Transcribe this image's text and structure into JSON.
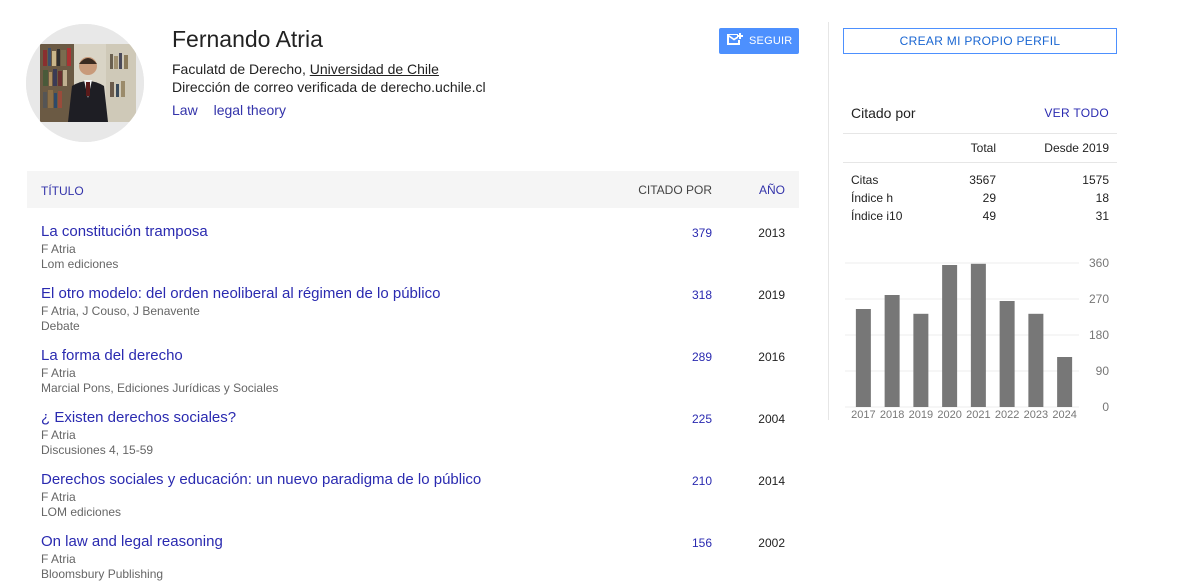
{
  "profile": {
    "name": "Fernando Atria",
    "affiliation_prefix": "Faculatd de Derecho, ",
    "affiliation_link": "Universidad de Chile",
    "email": "Dirección de correo verificada de derecho.uchile.cl",
    "tags": [
      "Law",
      "legal theory"
    ],
    "follow_label": "SEGUIR"
  },
  "table": {
    "headers": {
      "title": "TÍTULO",
      "cited_by": "CITADO POR",
      "year": "AÑO"
    },
    "articles": [
      {
        "title": "La constitución tramposa",
        "authors": "F Atria",
        "venue": "Lom ediciones",
        "cites": "379",
        "year": "2013"
      },
      {
        "title": "El otro modelo: del orden neoliberal al régimen de lo público",
        "authors": "F Atria, J Couso, J Benavente",
        "venue": "Debate",
        "cites": "318",
        "year": "2019"
      },
      {
        "title": "La forma del derecho",
        "authors": "F Atria",
        "venue": "Marcial Pons, Ediciones Jurídicas y Sociales",
        "cites": "289",
        "year": "2016"
      },
      {
        "title": "¿ Existen derechos sociales?",
        "authors": "F Atria",
        "venue": "Discusiones 4, 15-59",
        "cites": "225",
        "year": "2004"
      },
      {
        "title": "Derechos sociales y educación: un nuevo paradigma de lo público",
        "authors": "F Atria",
        "venue": "LOM ediciones",
        "cites": "210",
        "year": "2014"
      },
      {
        "title": "On law and legal reasoning",
        "authors": "F Atria",
        "venue": "Bloomsbury Publishing",
        "cites": "156",
        "year": "2002"
      }
    ]
  },
  "sidebar": {
    "create_profile_label": "CREAR MI PROPIO PERFIL",
    "cited_by_label": "Citado por",
    "view_all_label": "VER TODO",
    "stats_headers": {
      "total": "Total",
      "since": "Desde 2019"
    },
    "stats": [
      {
        "label": "Citas",
        "total": "3567",
        "since": "1575"
      },
      {
        "label": "Índice h",
        "total": "29",
        "since": "18"
      },
      {
        "label": "Índice i10",
        "total": "49",
        "since": "31"
      }
    ]
  },
  "chart_data": {
    "type": "bar",
    "categories": [
      "2017",
      "2018",
      "2019",
      "2020",
      "2021",
      "2022",
      "2023",
      "2024"
    ],
    "values": [
      245,
      280,
      233,
      355,
      358,
      265,
      233,
      125
    ],
    "yticks": [
      360,
      270,
      180,
      90,
      0
    ],
    "ylim": [
      0,
      360
    ],
    "title": "",
    "xlabel": "",
    "ylabel": "",
    "bar_color": "#777777"
  },
  "colors": {
    "accent": "#4d90fe",
    "link": "#2a2ab0"
  }
}
